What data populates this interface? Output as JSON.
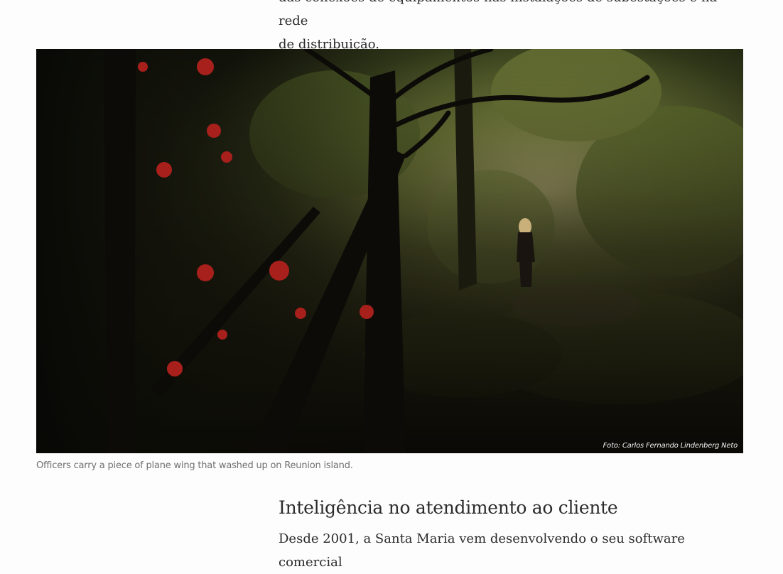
{
  "article": {
    "para_top_line1": "das conexões de equipamentos nas instalações de subestações e na rede",
    "para_top_line2": "de distribuição.",
    "image_credit": "Foto: Carlos Fernando Lindenberg Neto",
    "image_caption": "Officers carry a piece of plane wing that washed up on Reunion island.",
    "section_heading": "Inteligência no atendimento ao cliente",
    "para_bottom_line1": "Desde 2001, a Santa Maria vem desenvolvendo o seu software comercial"
  }
}
